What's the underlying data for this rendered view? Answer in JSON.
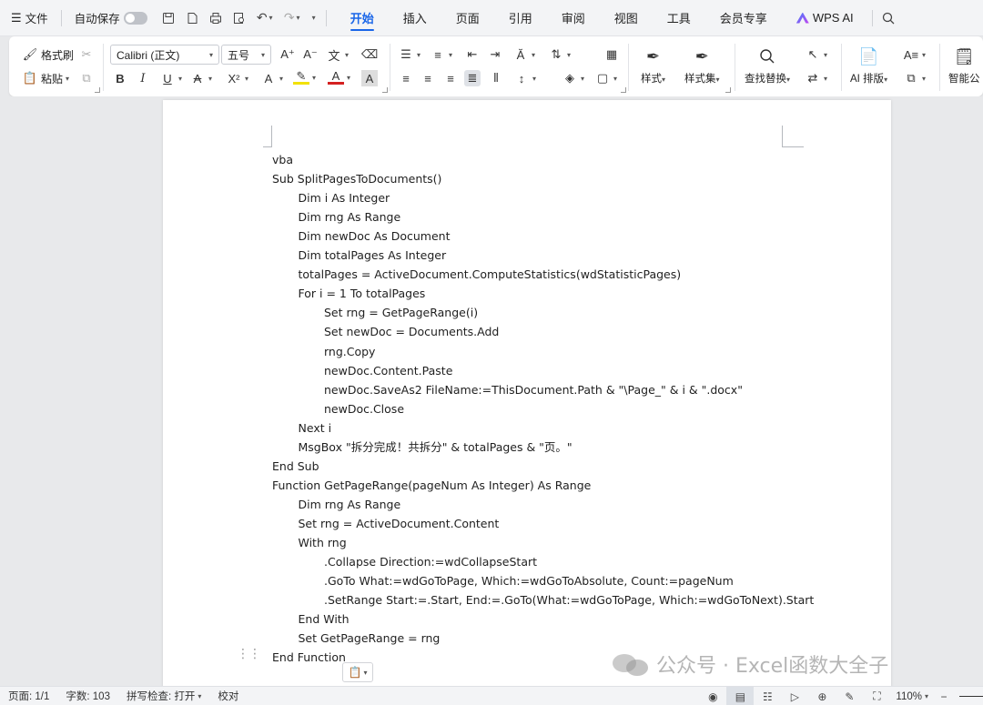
{
  "menubar": {
    "file_label": "文件",
    "autosave_label": "自动保存",
    "tabs": [
      {
        "label": "开始",
        "active": true
      },
      {
        "label": "插入",
        "active": false
      },
      {
        "label": "页面",
        "active": false
      },
      {
        "label": "引用",
        "active": false
      },
      {
        "label": "审阅",
        "active": false
      },
      {
        "label": "视图",
        "active": false
      },
      {
        "label": "工具",
        "active": false
      },
      {
        "label": "会员专享",
        "active": false
      }
    ],
    "wps_ai_label": "WPS AI",
    "accent_color": "#1a66e8"
  },
  "ribbon": {
    "format_painter_label": "格式刷",
    "paste_label": "粘贴",
    "font_name": "Calibri (正文)",
    "font_size": "五号",
    "styles_label": "样式",
    "style_set_label": "样式集",
    "find_replace_label": "查找替换",
    "ai_layout_label": "AI 排版",
    "smart_label": "智能公"
  },
  "document": {
    "lines": [
      {
        "indent": 0,
        "text": "vba"
      },
      {
        "indent": 0,
        "text": "Sub SplitPagesToDocuments()"
      },
      {
        "indent": 1,
        "text": "Dim i As Integer"
      },
      {
        "indent": 1,
        "text": "Dim rng As Range"
      },
      {
        "indent": 1,
        "text": "Dim newDoc As Document"
      },
      {
        "indent": 1,
        "text": "Dim totalPages As Integer"
      },
      {
        "indent": 1,
        "text": "totalPages = ActiveDocument.ComputeStatistics(wdStatisticPages)"
      },
      {
        "indent": 1,
        "text": "For i = 1 To totalPages"
      },
      {
        "indent": 2,
        "text": "Set rng = GetPageRange(i)"
      },
      {
        "indent": 2,
        "text": "Set newDoc = Documents.Add"
      },
      {
        "indent": 2,
        "text": "rng.Copy"
      },
      {
        "indent": 2,
        "text": "newDoc.Content.Paste"
      },
      {
        "indent": 2,
        "text": "newDoc.SaveAs2 FileName:=ThisDocument.Path & \"\\Page_\" & i & \".docx\""
      },
      {
        "indent": 2,
        "text": "newDoc.Close"
      },
      {
        "indent": 1,
        "text": "Next i"
      },
      {
        "indent": 1,
        "text": "MsgBox \"拆分完成！共拆分\" & totalPages & \"页。\""
      },
      {
        "indent": 0,
        "text": "End Sub"
      },
      {
        "indent": 0,
        "text": "Function GetPageRange(pageNum As Integer) As Range"
      },
      {
        "indent": 1,
        "text": "Dim rng As Range"
      },
      {
        "indent": 1,
        "text": "Set rng = ActiveDocument.Content"
      },
      {
        "indent": 1,
        "text": "With rng"
      },
      {
        "indent": 2,
        "text": ".Collapse Direction:=wdCollapseStart"
      },
      {
        "indent": 2,
        "text": ".GoTo What:=wdGoToPage, Which:=wdGoToAbsolute, Count:=pageNum"
      },
      {
        "indent": 2,
        "text": ".SetRange Start:=.Start, End:=.GoTo(What:=wdGoToPage, Which:=wdGoToNext).Start"
      },
      {
        "indent": 1,
        "text": "End With"
      },
      {
        "indent": 1,
        "text": "Set GetPageRange = rng"
      },
      {
        "indent": 0,
        "text": "End Function"
      }
    ]
  },
  "watermark": {
    "text": "公众号 · Excel函数大全子"
  },
  "statusbar": {
    "page": "页面: 1/1",
    "word_count": "字数: 103",
    "spell_check": "拼写检查: 打开",
    "proofread": "校对",
    "zoom": "110%"
  }
}
